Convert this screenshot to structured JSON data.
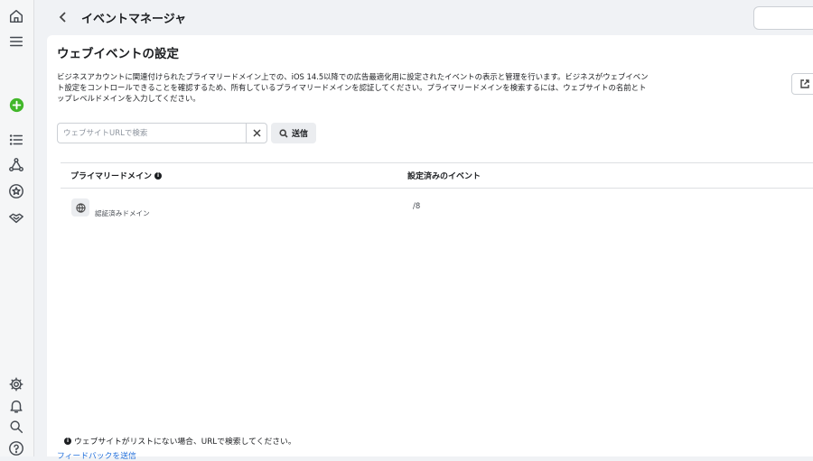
{
  "header": {
    "title": "イベントマネージャ"
  },
  "page": {
    "title": "ウェブイベントの設定",
    "description": "ビジネスアカウントに関連付けられたプライマリードメイン上での、iOS 14.5以降での広告最適化用に設定されたイベントの表示と管理を行います。ビジネスがウェブイベント設定をコントロールできることを確認するため、所有しているプライマリードメインを認証してください。プライマリードメインを検索するには、ウェブサイトの名前とトップレベルドメインを入力してください。"
  },
  "search": {
    "placeholder": "ウェブサイトURLで検索",
    "value": "",
    "send_label": "送信"
  },
  "table": {
    "columns": [
      "プライマリードメイン",
      "設定済みのイベント"
    ],
    "rows": [
      {
        "domain": "",
        "status": "認証済みドメイン",
        "events": "/8"
      }
    ]
  },
  "footer": {
    "note": "ウェブサイトがリストにない場合、URLで検索してください。",
    "feedback": "フィードバックを送信"
  },
  "icons": {
    "rail": [
      "home-icon",
      "menu-icon",
      "add-icon",
      "list-icon",
      "network-icon",
      "star-icon",
      "partner-icon",
      "settings-icon",
      "bell-icon",
      "search-icon",
      "help-icon"
    ]
  },
  "colors": {
    "accent_green": "#42b72a",
    "link_blue": "#216fdb"
  }
}
